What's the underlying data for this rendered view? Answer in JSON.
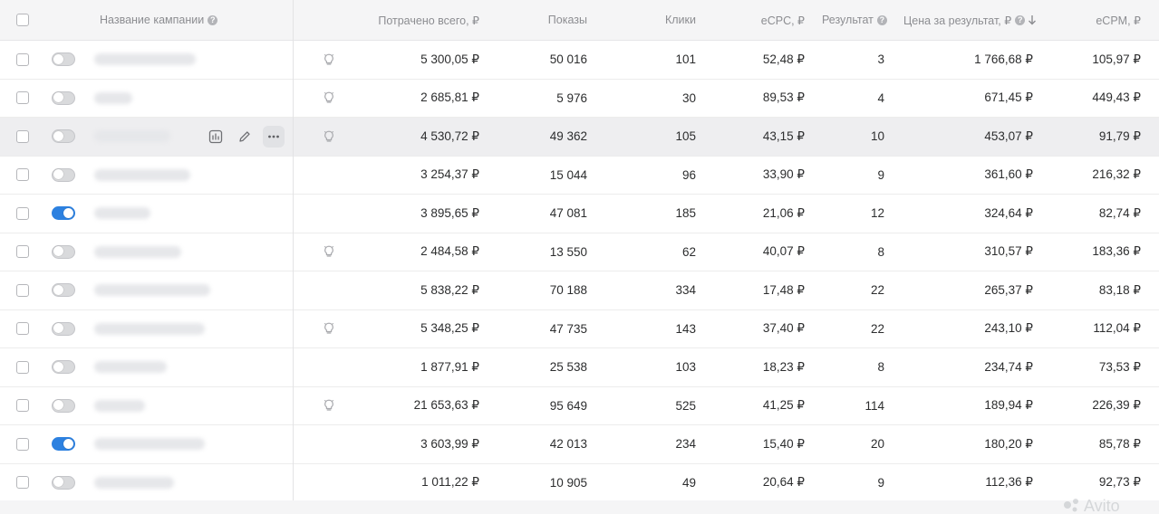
{
  "header": {
    "campaign_name": "Название кампании",
    "spent_total": "Потрачено всего, ₽",
    "impressions": "Показы",
    "clicks": "Клики",
    "ecpc": "eCPC, ₽",
    "result": "Результат",
    "price_per_result": "Цена за результат, ₽",
    "ecpm": "eCPM, ₽"
  },
  "rows": [
    {
      "toggle": "off",
      "bulb": true,
      "spent": "5 300,05 ₽",
      "impressions": "50 016",
      "clicks": "101",
      "ecpc": "52,48 ₽",
      "result": "3",
      "price": "1 766,68 ₽",
      "ecpm": "105,97 ₽"
    },
    {
      "toggle": "off",
      "bulb": true,
      "spent": "2 685,81 ₽",
      "impressions": "5 976",
      "clicks": "30",
      "ecpc": "89,53 ₽",
      "result": "4",
      "price": "671,45 ₽",
      "ecpm": "449,43 ₽"
    },
    {
      "toggle": "off",
      "bulb": true,
      "spent": "4 530,72 ₽",
      "impressions": "49 362",
      "clicks": "105",
      "ecpc": "43,15 ₽",
      "result": "10",
      "price": "453,07 ₽",
      "ecpm": "91,79 ₽"
    },
    {
      "toggle": "off",
      "bulb": false,
      "spent": "3 254,37 ₽",
      "impressions": "15 044",
      "clicks": "96",
      "ecpc": "33,90 ₽",
      "result": "9",
      "price": "361,60 ₽",
      "ecpm": "216,32 ₽"
    },
    {
      "toggle": "on",
      "bulb": false,
      "spent": "3 895,65 ₽",
      "impressions": "47 081",
      "clicks": "185",
      "ecpc": "21,06 ₽",
      "result": "12",
      "price": "324,64 ₽",
      "ecpm": "82,74 ₽"
    },
    {
      "toggle": "off",
      "bulb": true,
      "spent": "2 484,58 ₽",
      "impressions": "13 550",
      "clicks": "62",
      "ecpc": "40,07 ₽",
      "result": "8",
      "price": "310,57 ₽",
      "ecpm": "183,36 ₽"
    },
    {
      "toggle": "off",
      "bulb": false,
      "spent": "5 838,22 ₽",
      "impressions": "70 188",
      "clicks": "334",
      "ecpc": "17,48 ₽",
      "result": "22",
      "price": "265,37 ₽",
      "ecpm": "83,18 ₽"
    },
    {
      "toggle": "off",
      "bulb": true,
      "spent": "5 348,25 ₽",
      "impressions": "47 735",
      "clicks": "143",
      "ecpc": "37,40 ₽",
      "result": "22",
      "price": "243,10 ₽",
      "ecpm": "112,04 ₽"
    },
    {
      "toggle": "off",
      "bulb": false,
      "spent": "1 877,91 ₽",
      "impressions": "25 538",
      "clicks": "103",
      "ecpc": "18,23 ₽",
      "result": "8",
      "price": "234,74 ₽",
      "ecpm": "73,53 ₽"
    },
    {
      "toggle": "off",
      "bulb": true,
      "spent": "21 653,63 ₽",
      "impressions": "95 649",
      "clicks": "525",
      "ecpc": "41,25 ₽",
      "result": "114",
      "price": "189,94 ₽",
      "ecpm": "226,39 ₽"
    },
    {
      "toggle": "on",
      "bulb": false,
      "spent": "3 603,99 ₽",
      "impressions": "42 013",
      "clicks": "234",
      "ecpc": "15,40 ₽",
      "result": "20",
      "price": "180,20 ₽",
      "ecpm": "85,78 ₽"
    },
    {
      "toggle": "off",
      "bulb": false,
      "spent": "1 011,22 ₽",
      "impressions": "10 905",
      "clicks": "49",
      "ecpc": "20,64 ₽",
      "result": "9",
      "price": "112,36 ₽",
      "ecpm": "92,73 ₽"
    }
  ],
  "hover_row_index": 2,
  "watermark": "Avito",
  "colors": {
    "accent": "#2d81e0",
    "header_bg": "#f5f5f6",
    "hover_bg": "#eeeef0"
  }
}
